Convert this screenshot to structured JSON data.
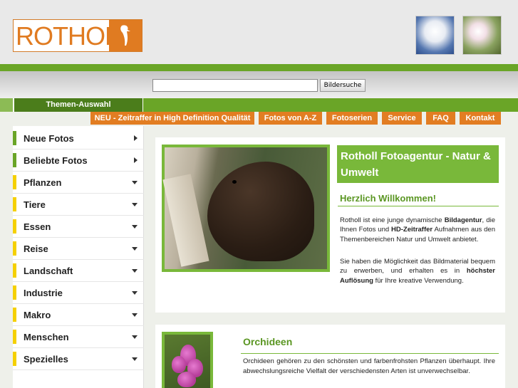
{
  "header": {
    "logo_text": "ROTHOLL",
    "thumbnails": [
      "snowy-tree-image",
      "apple-blossom-image"
    ]
  },
  "search": {
    "value": "",
    "button_label": "Bildersuche"
  },
  "themen_tab": "Themen-Auswahl",
  "nav": [
    {
      "label": "NEU - Zeitraffer in High Definition Qualität"
    },
    {
      "label": "Fotos von A-Z"
    },
    {
      "label": "Fotoserien"
    },
    {
      "label": "Service"
    },
    {
      "label": "FAQ"
    },
    {
      "label": "Kontakt"
    }
  ],
  "sidebar": {
    "items": [
      {
        "label": "Neue Fotos",
        "color": "#6aa527",
        "arrow": "right"
      },
      {
        "label": "Beliebte Fotos",
        "color": "#6aa527",
        "arrow": "right"
      },
      {
        "label": "Pflanzen",
        "color": "#f5d000",
        "arrow": "down"
      },
      {
        "label": "Tiere",
        "color": "#f5d000",
        "arrow": "down"
      },
      {
        "label": "Essen",
        "color": "#f5d000",
        "arrow": "down"
      },
      {
        "label": "Reise",
        "color": "#f5d000",
        "arrow": "down"
      },
      {
        "label": "Landschaft",
        "color": "#f5d000",
        "arrow": "down"
      },
      {
        "label": "Industrie",
        "color": "#f5d000",
        "arrow": "down"
      },
      {
        "label": "Makro",
        "color": "#f5d000",
        "arrow": "down"
      },
      {
        "label": "Menschen",
        "color": "#f5d000",
        "arrow": "down"
      },
      {
        "label": "Spezielles",
        "color": "#f5d000",
        "arrow": "down"
      }
    ]
  },
  "intro": {
    "title": "Rotholl Fotoagentur - Natur & Umwelt",
    "welcome": "Herzlich Willkommen!",
    "p1_a": "Rotholl ist eine junge dynamische ",
    "p1_b": "Bildagentur",
    "p1_c": ", die Ihnen Fotos und ",
    "p1_d": "HD-Zeitraffer",
    "p1_e": " Aufnahmen aus den Themenbereichen Natur und Umwelt anbietet.",
    "p2_a": "Sie haben die Möglichkeit das Bildmaterial bequem zu erwerben, und erhalten es in ",
    "p2_b": "höchster Auflösung",
    "p2_c": " für Ihre kreative Verwendung."
  },
  "orchid": {
    "title": "Orchideen",
    "text": "Orchideen gehören zu den schönsten und farbenfrohsten Pflanzen überhaupt. Ihre abwechslungsreiche Vielfalt der verschiedensten Arten ist unverwechselbar."
  },
  "colors": {
    "brand_orange": "#e07b21",
    "brand_green": "#6aa527",
    "accent_yellow": "#f5d000"
  }
}
